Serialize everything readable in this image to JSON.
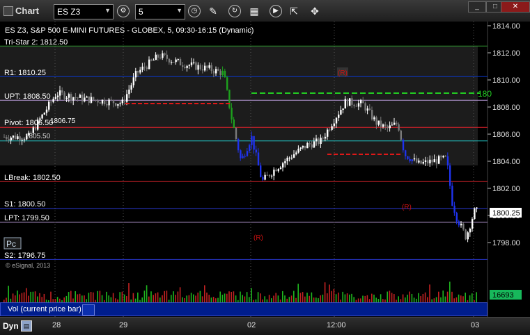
{
  "window": {
    "title": "Chart",
    "symbol": "ES Z3",
    "interval": "5"
  },
  "chart": {
    "description": "ES Z3, S&P 500 E-MINI FUTURES - GLOBEX, 5, 09:30-16:15 (Dynamic)",
    "tristar": "Tri-Star 2: 1812.50",
    "copyright": "© eSignal, 2013",
    "pc_button": "Pc",
    "levels": [
      {
        "label": "R1: 1810.25",
        "price": 1810.25,
        "color": "#0a3ad6"
      },
      {
        "label": "UPT: 1808.50",
        "price": 1808.5,
        "color": "#b89ad8"
      },
      {
        "label": "Pivot: 1806.50",
        "price": 1806.5,
        "color": "#e0202a"
      },
      {
        "label": "1805.50",
        "price": 1805.5,
        "color": "#22c8c8"
      },
      {
        "label": "LBreak: 1802.50",
        "price": 1802.5,
        "color": "#d0222a"
      },
      {
        "label": "S1: 1800.50",
        "price": 1800.5,
        "color": "#2a3ad6"
      },
      {
        "label": "LPT: 1799.50",
        "price": 1799.5,
        "color": "#b89ad8"
      },
      {
        "label": "S2: 1796.75",
        "price": 1796.75,
        "color": "#2a3ad6"
      }
    ],
    "pivot_extra_label": "1806.75",
    "green_dashed_label": "180",
    "price_axis": [
      "1814.00",
      "1812.00",
      "1810.00",
      "1808.00",
      "1806.00",
      "1804.00",
      "1802.00",
      "1800.00",
      "1798.00"
    ],
    "last_price": "1800.25",
    "volume_last": "16693",
    "markers": {
      "r1": "(R)",
      "r2": "(R)",
      "r3": "(R)"
    },
    "volume_label": "Vol (current price bar)"
  },
  "chart_data": {
    "type": "candlestick",
    "ylim": [
      1796.5,
      1814.3
    ],
    "levels": [
      1810.25,
      1808.5,
      1806.5,
      1805.5,
      1802.5,
      1800.5,
      1799.5,
      1796.75
    ],
    "last_price": 1800.25,
    "last_volume": 16693
  },
  "xaxis": {
    "labels": [
      "28",
      "29",
      "02",
      "12:00",
      "03"
    ]
  },
  "bottom": {
    "dyn": "Dyn"
  }
}
